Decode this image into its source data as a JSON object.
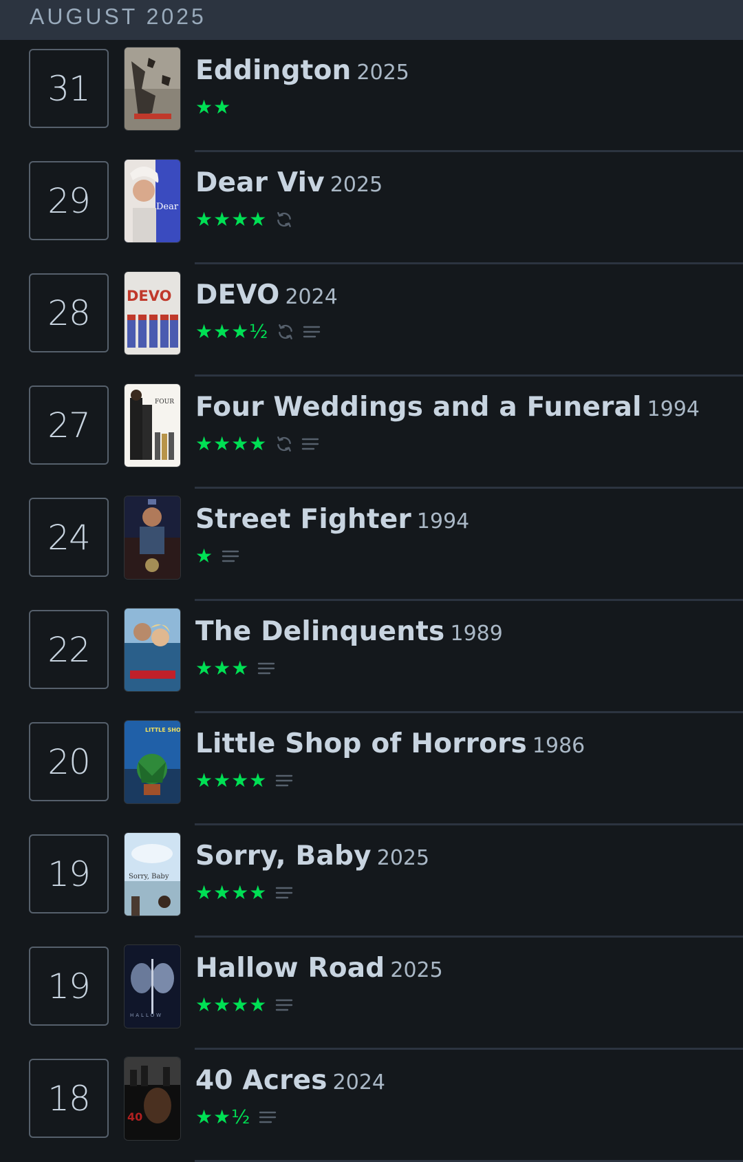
{
  "month": {
    "label": "AUGUST 2025"
  },
  "colors": {
    "background": "#14181c",
    "header": "#2c3440",
    "star": "#00e054",
    "text": "#c8d4e0",
    "icon": "#56606c"
  },
  "entries": [
    {
      "day": "31",
      "title": "Eddington",
      "year": "2025",
      "stars": "★★",
      "rewatch": false,
      "review": false,
      "poster": "eddington"
    },
    {
      "day": "29",
      "title": "Dear Viv",
      "year": "2025",
      "stars": "★★★★",
      "rewatch": true,
      "review": false,
      "poster": "dear-viv",
      "poster_text": "Dear Viv"
    },
    {
      "day": "28",
      "title": "DEVO",
      "year": "2024",
      "stars": "★★★½",
      "rewatch": true,
      "review": true,
      "poster": "devo",
      "poster_text": "DEVO"
    },
    {
      "day": "27",
      "title": "Four Weddings and a Funeral",
      "year": "1994",
      "stars": "★★★★",
      "rewatch": true,
      "review": true,
      "poster": "four-weddings"
    },
    {
      "day": "24",
      "title": "Street Fighter",
      "year": "1994",
      "stars": "★",
      "rewatch": false,
      "review": true,
      "poster": "street-fighter"
    },
    {
      "day": "22",
      "title": "The Delinquents",
      "year": "1989",
      "stars": "★★★",
      "rewatch": false,
      "review": true,
      "poster": "delinquents"
    },
    {
      "day": "20",
      "title": "Little Shop of Horrors",
      "year": "1986",
      "stars": "★★★★",
      "rewatch": false,
      "review": true,
      "poster": "little-shop"
    },
    {
      "day": "19",
      "title": "Sorry, Baby",
      "year": "2025",
      "stars": "★★★★",
      "rewatch": false,
      "review": true,
      "poster": "sorry-baby",
      "poster_text": "Sorry, Baby"
    },
    {
      "day": "19",
      "title": "Hallow Road",
      "year": "2025",
      "stars": "★★★★",
      "rewatch": false,
      "review": true,
      "poster": "hallow-road"
    },
    {
      "day": "18",
      "title": "40 Acres",
      "year": "2024",
      "stars": "★★½",
      "rewatch": false,
      "review": true,
      "poster": "40-acres"
    }
  ]
}
